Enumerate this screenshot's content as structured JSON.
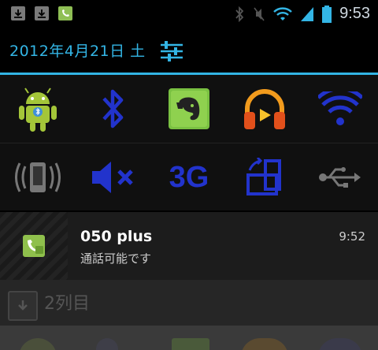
{
  "status_bar": {
    "time": "9:53",
    "left_icons": [
      "download-icon",
      "download-icon",
      "ip-phone-app-icon"
    ],
    "right_icons": [
      "bluetooth-icon",
      "mute-icon",
      "wifi-icon",
      "signal-icon",
      "battery-icon"
    ]
  },
  "header": {
    "date": "2012年4月21日 土",
    "settings_icon": "settings-sliders-icon"
  },
  "toggles": {
    "row1": [
      "android-icon",
      "bluetooth-icon",
      "evernote-icon",
      "headphones-icon",
      "wifi-icon"
    ],
    "row2": [
      "vibrate-icon",
      "mute-icon",
      "3G",
      "rotate-icon",
      "usb-icon"
    ],
    "label_3g": "3G"
  },
  "notification": {
    "title": "050 plus",
    "text": "通話可能です",
    "time": "9:52",
    "icon": "ip-phone-app-icon"
  },
  "ghost_row": {
    "label": "2列目"
  },
  "colors": {
    "accent": "#33b5e5",
    "toggle_blue": "#2233cc",
    "android_green": "#a4c639"
  }
}
